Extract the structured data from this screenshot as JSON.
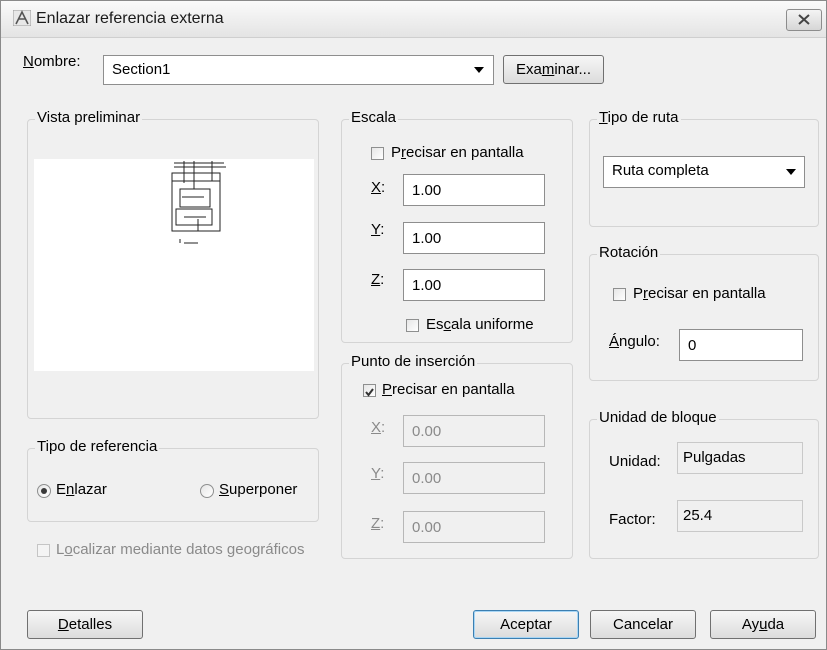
{
  "window": {
    "title": "Enlazar referencia externa",
    "app_icon": "autocad-icon",
    "close_icon": "close-icon"
  },
  "name_row": {
    "label": "Nombre:",
    "value": "Section1",
    "browse_label": "Examinar..."
  },
  "preview": {
    "legend": "Vista preliminar"
  },
  "reference_type": {
    "legend": "Tipo de referencia",
    "options": [
      "Enlazar",
      "Superponer"
    ],
    "selected": "Enlazar"
  },
  "geo_locate": {
    "label": "Localizar mediante datos geográficos",
    "checked": false,
    "enabled": false
  },
  "scale": {
    "legend": "Escala",
    "specify_on_screen": "Precisar en pantalla",
    "x_label": "X:",
    "x_value": "1.00",
    "y_label": "Y:",
    "y_value": "1.00",
    "z_label": "Z:",
    "z_value": "1.00",
    "uniform_label": "Escala uniforme"
  },
  "insertion": {
    "legend": "Punto de inserción",
    "specify_on_screen": "Precisar en pantalla",
    "checked": true,
    "x_label": "X:",
    "x_value": "0.00",
    "y_label": "Y:",
    "y_value": "0.00",
    "z_label": "Z:",
    "z_value": "0.00"
  },
  "path_type": {
    "legend": "Tipo de ruta",
    "value": "Ruta completa"
  },
  "rotation": {
    "legend": "Rotación",
    "specify_on_screen": "Precisar en pantalla",
    "angle_label": "Ángulo:",
    "angle_value": "0"
  },
  "block_unit": {
    "legend": "Unidad de bloque",
    "unit_label": "Unidad:",
    "unit_value": "Pulgadas",
    "factor_label": "Factor:",
    "factor_value": "25.4"
  },
  "buttons": {
    "details": "Detalles",
    "ok": "Aceptar",
    "cancel": "Cancelar",
    "help": "Ayuda"
  }
}
